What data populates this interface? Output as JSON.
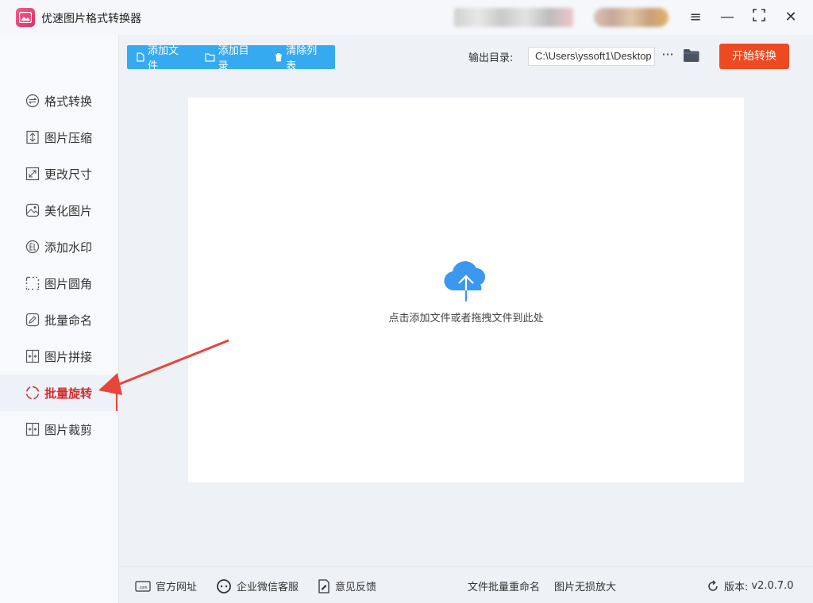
{
  "window": {
    "title": "优速图片格式转换器",
    "controls": {
      "menu": "≡",
      "minimize": "—",
      "maximize": "⛶",
      "close": "✕"
    }
  },
  "sidebar": {
    "items": [
      {
        "label": "格式转换",
        "icon": "format-convert-icon"
      },
      {
        "label": "图片压缩",
        "icon": "compress-icon"
      },
      {
        "label": "更改尺寸",
        "icon": "resize-icon"
      },
      {
        "label": "美化图片",
        "icon": "beautify-icon"
      },
      {
        "label": "添加水印",
        "icon": "watermark-icon"
      },
      {
        "label": "图片圆角",
        "icon": "round-corner-icon"
      },
      {
        "label": "批量命名",
        "icon": "rename-icon"
      },
      {
        "label": "图片拼接",
        "icon": "stitch-icon"
      },
      {
        "label": "批量旋转",
        "icon": "rotate-icon",
        "active": true
      },
      {
        "label": "图片裁剪",
        "icon": "crop-icon"
      }
    ]
  },
  "toolbar": {
    "add_file": "添加文件",
    "add_folder": "添加目录",
    "clear_list": "清除列表",
    "output_label": "输出目录:",
    "output_path": "C:\\Users\\yssoft1\\Desktop",
    "more": "···",
    "start": "开始转换"
  },
  "dropzone": {
    "hint": "点击添加文件或者拖拽文件到此处"
  },
  "footer": {
    "website": "官方网址",
    "wechat": "企业微信客服",
    "feedback": "意见反馈",
    "batch_rename": "文件批量重命名",
    "lossless_zoom": "图片无损放大",
    "version_label": "版本:",
    "version": "v2.0.7.0"
  },
  "colors": {
    "accent_blue": "#35aaf0",
    "start_orange": "#ed4a21",
    "active_red": "#d42c2c",
    "annotation_arrow": "#e8453c"
  }
}
